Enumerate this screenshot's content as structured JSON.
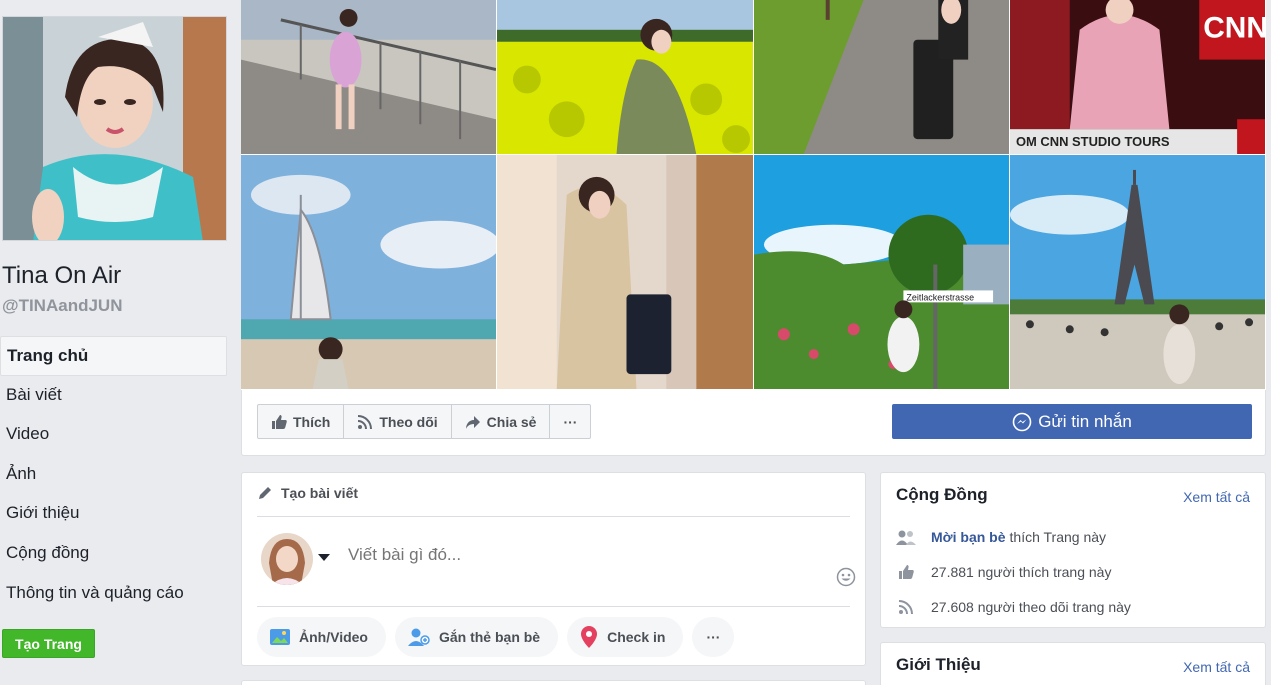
{
  "profile": {
    "name": "Tina On Air",
    "handle": "@TINAandJUN"
  },
  "nav": {
    "items": [
      {
        "label": "Trang chủ"
      },
      {
        "label": "Bài viết"
      },
      {
        "label": "Video"
      },
      {
        "label": "Ảnh"
      },
      {
        "label": "Giới thiệu"
      },
      {
        "label": "Cộng đồng"
      },
      {
        "label": "Thông tin và quảng cáo"
      }
    ],
    "create_page": "Tạo Trang"
  },
  "cover": {
    "cnn_text": "CNN",
    "cnn_banner": "OM CNN STUDIO TOURS",
    "street_sign": "Zeitlackerstrasse"
  },
  "actions": {
    "like": "Thích",
    "follow": "Theo dõi",
    "share": "Chia sẻ",
    "more": "···",
    "send_message": "Gửi tin nhắn"
  },
  "composer": {
    "title": "Tạo bài viết",
    "placeholder": "Viết bài gì đó...",
    "photo_video": "Ảnh/Video",
    "tag_friends": "Gắn thẻ bạn bè",
    "check_in": "Check in",
    "more": "···"
  },
  "community": {
    "title": "Cộng Đồng",
    "see_all": "Xem tất cả",
    "invite_link": "Mời bạn bè",
    "invite_rest": "thích Trang này",
    "likes": "27.881 người thích trang này",
    "follows": "27.608 người theo dõi trang này"
  },
  "about": {
    "title": "Giới Thiệu",
    "see_all": "Xem tất cả"
  },
  "colors": {
    "facebook_blue": "#4267b2",
    "create_green": "#42b72a",
    "background": "#e9ebee"
  }
}
